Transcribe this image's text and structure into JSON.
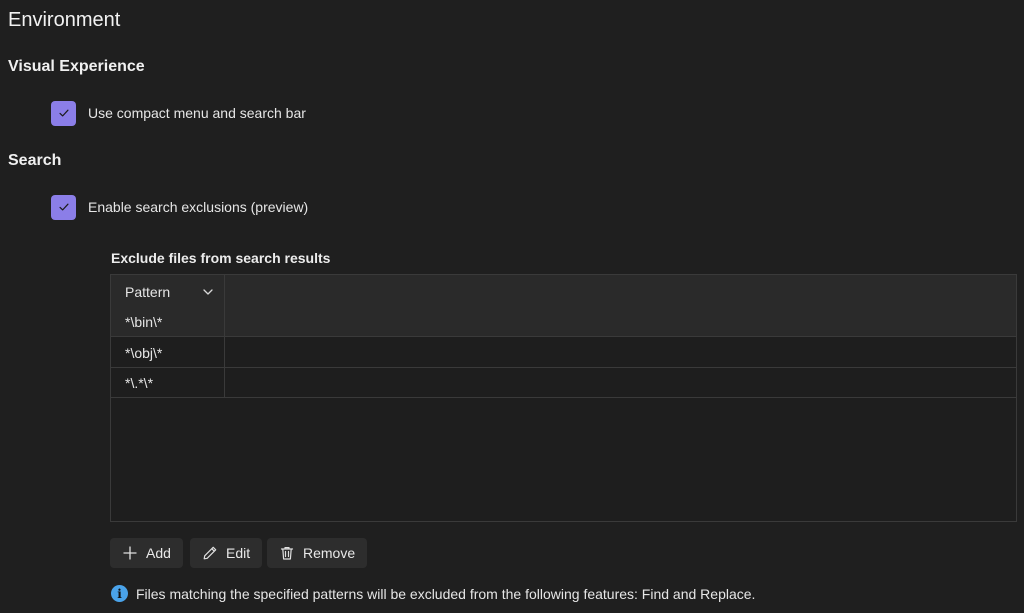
{
  "page": {
    "title": "Environment"
  },
  "visual_experience": {
    "heading": "Visual Experience",
    "compact_menu": {
      "label": "Use compact menu and search bar",
      "checked": true
    }
  },
  "search": {
    "heading": "Search",
    "exclusions": {
      "label": "Enable search exclusions (preview)",
      "checked": true
    },
    "table": {
      "title": "Exclude files from search results",
      "column_header": "Pattern",
      "rows": [
        "*\\bin\\*",
        "*\\obj\\*",
        "*\\.*\\*"
      ]
    },
    "buttons": {
      "add": "Add",
      "edit": "Edit",
      "remove": "Remove"
    },
    "info_text": "Files matching the specified patterns will be excluded from the following features: Find and Replace."
  },
  "colors": {
    "background": "#1f1f1f",
    "checkbox_accent": "#8b7ee8",
    "info_accent": "#4aa3ea"
  },
  "icons": {
    "checkbox": "check-icon",
    "column_sort": "chevron-down-icon",
    "add": "plus-icon",
    "edit": "pencil-icon",
    "remove": "trash-icon",
    "info": "info-icon"
  }
}
